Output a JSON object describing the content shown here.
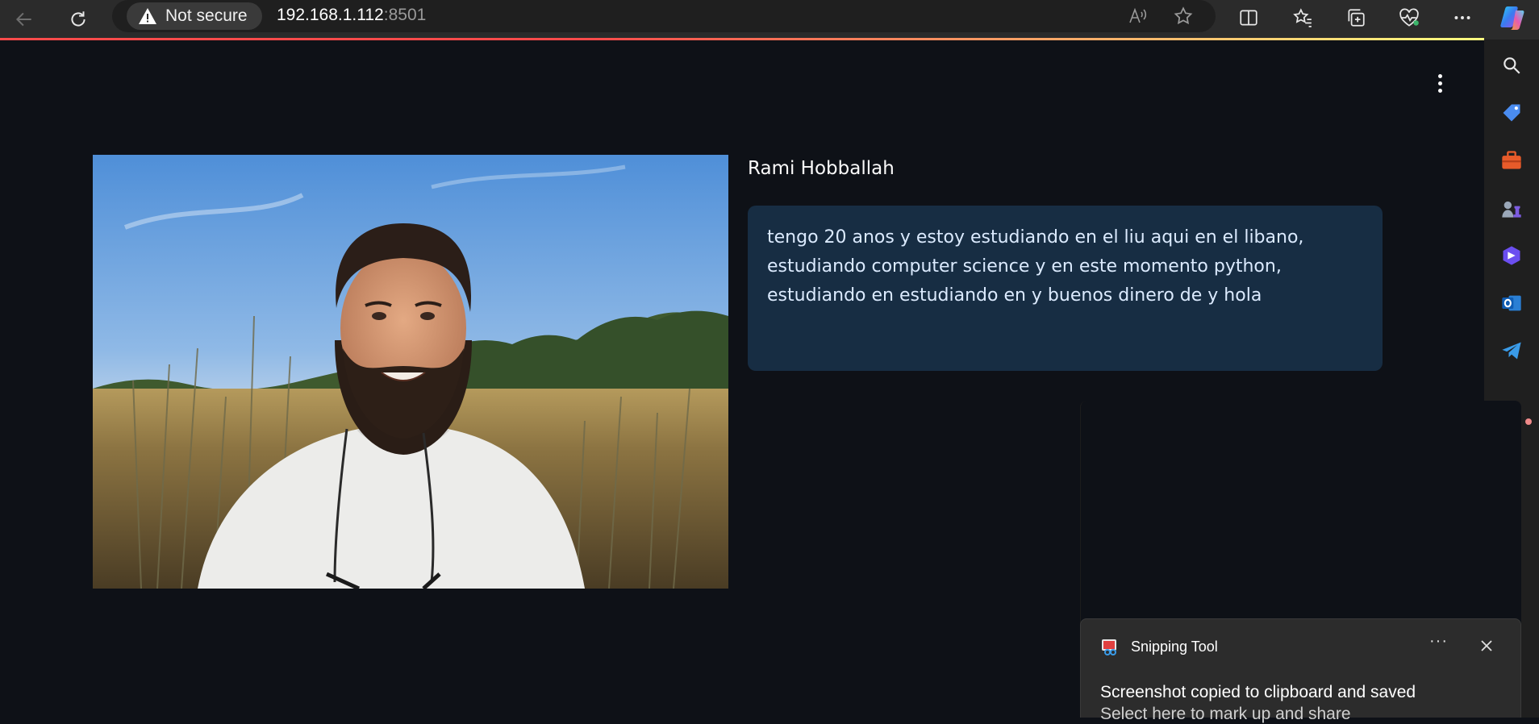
{
  "browser": {
    "security_label": "Not secure",
    "url_host": "192.168.1.112",
    "url_port": ":8501",
    "icons": {
      "back": "back-arrow-icon",
      "reload": "reload-icon",
      "warning": "warning-icon",
      "read_aloud": "read-aloud-icon",
      "favorite": "star-icon",
      "split_screen": "split-screen-icon",
      "favorites": "favorites-icon",
      "collections": "collections-icon",
      "health": "browser-essentials-icon",
      "more": "more-icon",
      "copilot": "copilot-icon"
    }
  },
  "sidebar": {
    "items": [
      "search-icon",
      "shopping-tag-icon",
      "tools-icon",
      "games-icon",
      "bing-chat-icon",
      "outlook-icon",
      "telegram-icon"
    ]
  },
  "main": {
    "profile_name": "Rami Hobballah",
    "bio": "tengo 20 anos y estoy estudiando en el liu aqui en el libano, estudiando computer science y en este momento python, estudiando en estudiando en y buenos dinero de y hola"
  },
  "notification": {
    "app_name": "Snipping Tool",
    "more_label": "···",
    "title": "Screenshot copied to clipboard and saved",
    "subtitle": "Select here to mark up and share"
  },
  "colors": {
    "page_bg": "#0e1117",
    "info_bg": "#172d43",
    "info_text": "#dbeafe",
    "accent": "#ff4b4b"
  }
}
